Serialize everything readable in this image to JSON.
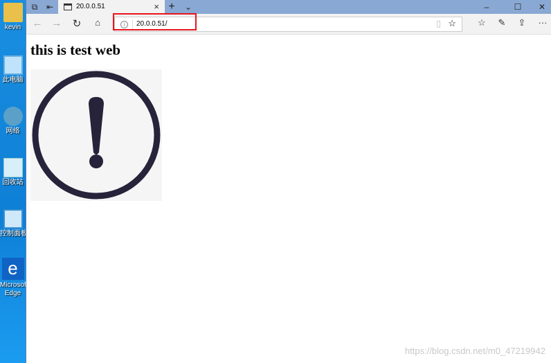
{
  "desktop": {
    "icons": [
      {
        "label": "kevin",
        "icon": "user-folder-icon"
      },
      {
        "label": "此电脑",
        "icon": "computer-icon"
      },
      {
        "label": "网络",
        "icon": "network-icon"
      },
      {
        "label": "回收站",
        "icon": "recycle-bin-icon"
      },
      {
        "label": "控制面板",
        "icon": "control-panel-icon"
      },
      {
        "label": "Microsoft Edge",
        "icon": "edge-icon"
      }
    ]
  },
  "browser": {
    "tab_title": "20.0.0.51",
    "address": "20.0.0.51/",
    "highlight_color": "#e8141b"
  },
  "page": {
    "heading": "this is test web",
    "image": "exclamation-circle-icon"
  },
  "watermark": "https://blog.csdn.net/m0_47219942"
}
